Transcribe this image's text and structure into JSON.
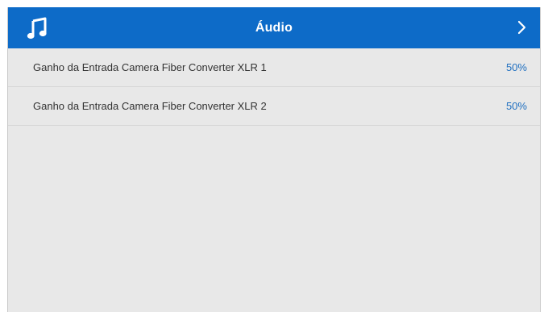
{
  "header": {
    "title": "Áudio",
    "icon": "music-note-icon",
    "nav_icon": "chevron-right-icon",
    "background_color": "#0d6bc8"
  },
  "settings": [
    {
      "label": "Ganho da Entrada Camera Fiber Converter XLR 1",
      "value": "50%"
    },
    {
      "label": "Ganho da Entrada Camera Fiber Converter XLR 2",
      "value": "50%"
    }
  ],
  "colors": {
    "panel_background": "#e8e8e8",
    "value_text": "#1f6fc0",
    "label_text": "#333333"
  }
}
